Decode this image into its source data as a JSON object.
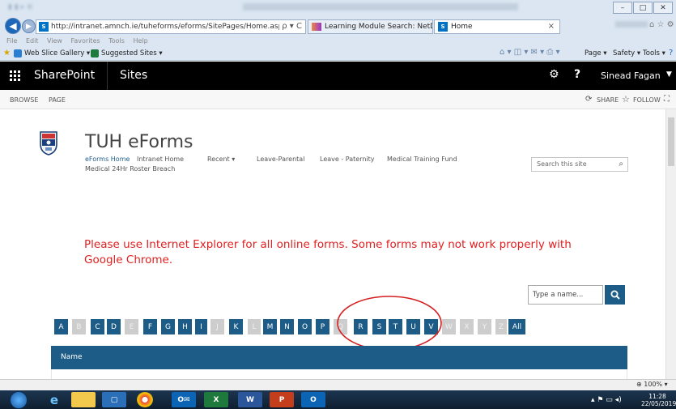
{
  "browser": {
    "address_url": "http://intranet.amnch.ie/tuheforms/eforms/SitePages/Home.aspx",
    "address_controls": "ρ ▾ C",
    "tabs": [
      {
        "label": "Learning Module Search: NetD..."
      },
      {
        "label": "Home"
      }
    ],
    "tab_close": "×",
    "menu": [
      "File",
      "Edit",
      "View",
      "Favorites",
      "Tools",
      "Help"
    ],
    "favorites": [
      {
        "label": "Web Slice Gallery ▾"
      },
      {
        "label": "Suggested Sites ▾"
      }
    ],
    "command_bar": [
      "Page ▾",
      "Safety ▾",
      "Tools ▾"
    ],
    "zoom": "100%"
  },
  "suite_bar": {
    "brand": "SharePoint",
    "sites": "Sites",
    "help": "?",
    "user": "Sinead Fagan"
  },
  "ribbon": {
    "tabs": [
      "BROWSE",
      "PAGE"
    ],
    "share": "SHARE",
    "follow": "FOLLOW"
  },
  "site": {
    "title": "TUH eForms",
    "nav": [
      {
        "label": "eForms Home",
        "active": true
      },
      {
        "label": "Intranet Home"
      },
      {
        "label": "Recent ▾"
      },
      {
        "label": "Leave-Parental"
      },
      {
        "label": "Leave - Paternity"
      },
      {
        "label": "Medical Training Fund"
      },
      {
        "label": "Medical 24Hr Roster Breach"
      }
    ],
    "search_placeholder": "Search this site",
    "notice": "Please use Internet Explorer for all online forms. Some forms may not work properly with Google Chrome.",
    "name_placeholder": "Type a name...",
    "letters": [
      {
        "l": "A",
        "on": true
      },
      {
        "l": "B",
        "on": false
      },
      {
        "l": "C",
        "on": true
      },
      {
        "l": "D",
        "on": true
      },
      {
        "l": "E",
        "on": false
      },
      {
        "l": "F",
        "on": true
      },
      {
        "l": "G",
        "on": true
      },
      {
        "l": "H",
        "on": true
      },
      {
        "l": "I",
        "on": true
      },
      {
        "l": "J",
        "on": false
      },
      {
        "l": "K",
        "on": true
      },
      {
        "l": "L",
        "on": false
      },
      {
        "l": "M",
        "on": true
      },
      {
        "l": "N",
        "on": true
      },
      {
        "l": "O",
        "on": true
      },
      {
        "l": "P",
        "on": true
      },
      {
        "l": "Q",
        "on": false
      },
      {
        "l": "R",
        "on": true
      },
      {
        "l": "S",
        "on": true
      },
      {
        "l": "T",
        "on": true
      },
      {
        "l": "U",
        "on": true
      },
      {
        "l": "V",
        "on": true
      },
      {
        "l": "W",
        "on": false
      },
      {
        "l": "X",
        "on": false
      },
      {
        "l": "Y",
        "on": false
      },
      {
        "l": "Z",
        "on": false
      },
      {
        "l": "All",
        "on": true
      }
    ],
    "table_header": "Name"
  },
  "taskbar": {
    "clock_time": "11:28",
    "clock_date": "22/05/2019"
  },
  "colors": {
    "accent": "#1e5c88",
    "notice": "#e02020",
    "annotation": "#d42020"
  }
}
